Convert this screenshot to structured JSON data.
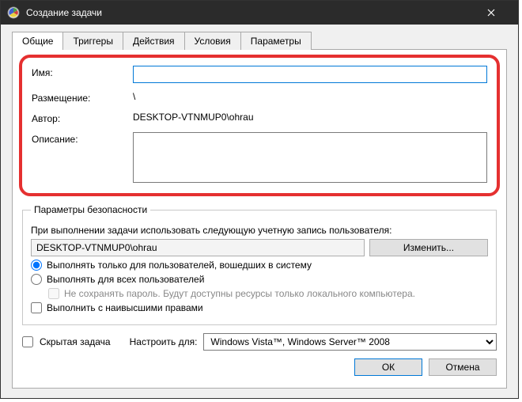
{
  "window": {
    "title": "Создание задачи"
  },
  "tabs": {
    "general": "Общие",
    "triggers": "Триггеры",
    "actions": "Действия",
    "conditions": "Условия",
    "settings": "Параметры"
  },
  "general": {
    "name_label": "Имя:",
    "name_value": "",
    "location_label": "Размещение:",
    "location_value": "\\",
    "author_label": "Автор:",
    "author_value": "DESKTOP-VTNMUP0\\ohrau",
    "description_label": "Описание:",
    "description_value": ""
  },
  "security": {
    "legend": "Параметры безопасности",
    "run_as_text": "При выполнении задачи использовать следующую учетную запись пользователя:",
    "account": "DESKTOP-VTNMUP0\\ohrau",
    "change_btn": "Изменить...",
    "radio_logged_on": "Выполнять только для пользователей, вошедших в систему",
    "radio_all_users": "Выполнять для всех пользователей",
    "no_store_password": "Не сохранять пароль. Будут доступны ресурсы только локального компьютера.",
    "highest_priv": "Выполнить с наивысшими правами"
  },
  "bottom": {
    "hidden_task": "Скрытая задача",
    "configure_for_label": "Настроить для:",
    "configure_for_value": "Windows Vista™, Windows Server™ 2008"
  },
  "buttons": {
    "ok": "ОК",
    "cancel": "Отмена"
  }
}
